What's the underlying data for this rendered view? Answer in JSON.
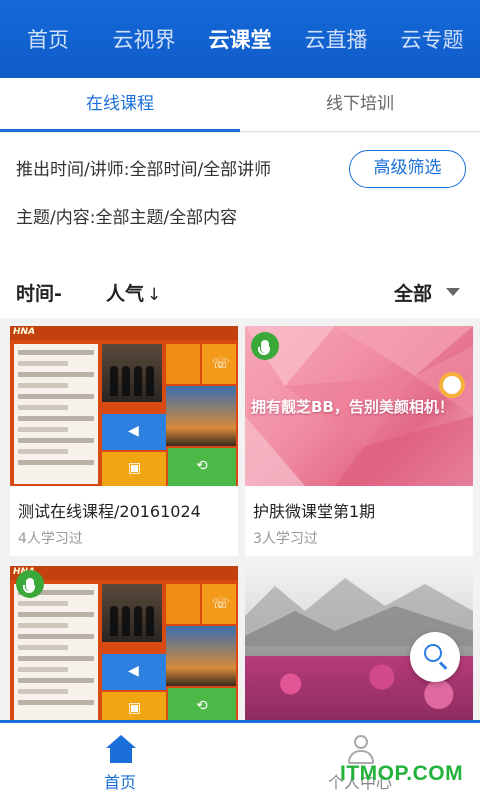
{
  "top_nav": {
    "items": [
      {
        "label": "首页",
        "active": false
      },
      {
        "label": "云视界",
        "active": false
      },
      {
        "label": "云课堂",
        "active": true
      },
      {
        "label": "云直播",
        "active": false
      },
      {
        "label": "云专题",
        "active": false
      }
    ],
    "background_color": "#1568d8"
  },
  "sub_tabs": {
    "items": [
      {
        "label": "在线课程",
        "active": true
      },
      {
        "label": "线下培训",
        "active": false
      }
    ],
    "accent_color": "#1a6fd8"
  },
  "filters": {
    "time_teacher": "推出时间/讲师:全部时间/全部讲师",
    "topic_content": "主题/内容:全部主题/全部内容",
    "advanced_button": "高级筛选"
  },
  "sort": {
    "time_label": "时间-",
    "popularity_label": "人气",
    "popularity_arrow": "↓",
    "category_label": "全部",
    "category_icon": "caret-down-icon"
  },
  "courses": [
    {
      "title": "测试在线课程/20161024",
      "learners": "4人学习过",
      "thumb": "app-screenshot",
      "has_mic_badge": false
    },
    {
      "title": "护肤微课堂第1期",
      "learners": "3人学习过",
      "thumb": "pink-polygon",
      "has_mic_badge": true,
      "slogan": "拥有靓芝BB，告别美颜相机！"
    },
    {
      "title": "",
      "learners": "",
      "thumb": "app-screenshot",
      "has_mic_badge": true
    },
    {
      "title": "",
      "learners": "",
      "thumb": "landscape",
      "has_mic_badge": false
    }
  ],
  "thumb_text": {
    "hna": "HNA"
  },
  "search_fab": {
    "icon": "search-icon"
  },
  "bottom_nav": {
    "items": [
      {
        "label": "首页",
        "icon": "home-icon",
        "active": true
      },
      {
        "label": "个人中心",
        "icon": "user-icon",
        "active": false
      }
    ]
  },
  "watermark": "ITMOP.COM"
}
